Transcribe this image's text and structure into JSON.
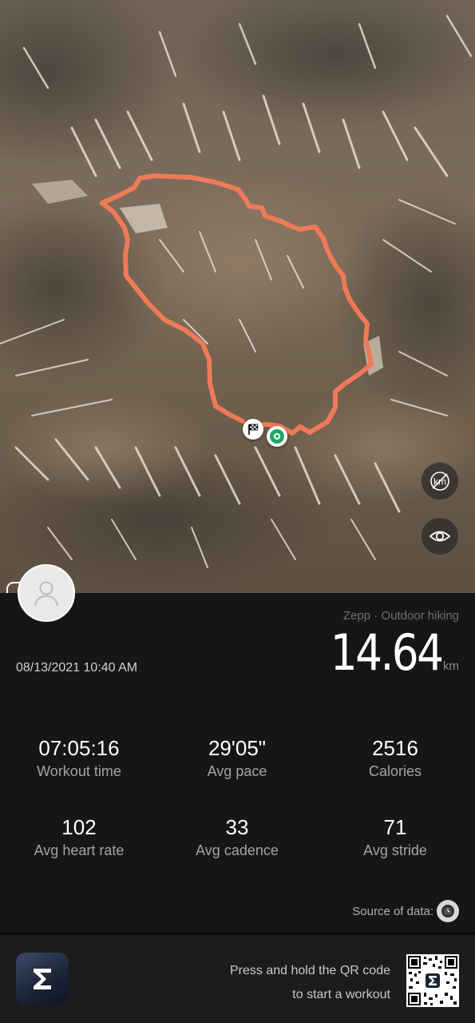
{
  "map": {
    "km_toggle_icon": "km-off-icon",
    "visibility_icon": "eye-icon",
    "start_marker_icon": "checkered-flag-icon",
    "end_marker_icon": "end-point-icon",
    "route_color": "#ef7a58"
  },
  "header": {
    "source_line": "Zepp · Outdoor hiking",
    "distance_value": "14.64",
    "distance_unit": "km",
    "datetime": "08/13/2021 10:40 AM"
  },
  "stats": [
    {
      "value": "07:05:16",
      "label": "Workout time"
    },
    {
      "value": "29'05\"",
      "label": "Avg pace"
    },
    {
      "value": "2516",
      "label": "Calories"
    },
    {
      "value": "102",
      "label": "Avg heart rate"
    },
    {
      "value": "33",
      "label": "Avg cadence"
    },
    {
      "value": "71",
      "label": "Avg stride"
    }
  ],
  "source": {
    "label": "Source of data:",
    "device_icon": "watch-icon"
  },
  "footer": {
    "app_logo_icon": "zepp-logo-icon",
    "promo_line1": "Press and hold the QR code",
    "promo_line2": "to start a workout",
    "qr_icon": "qr-code-icon"
  },
  "colors": {
    "background": "#161616",
    "route": "#ef7a58",
    "end_marker": "#1fa765"
  }
}
